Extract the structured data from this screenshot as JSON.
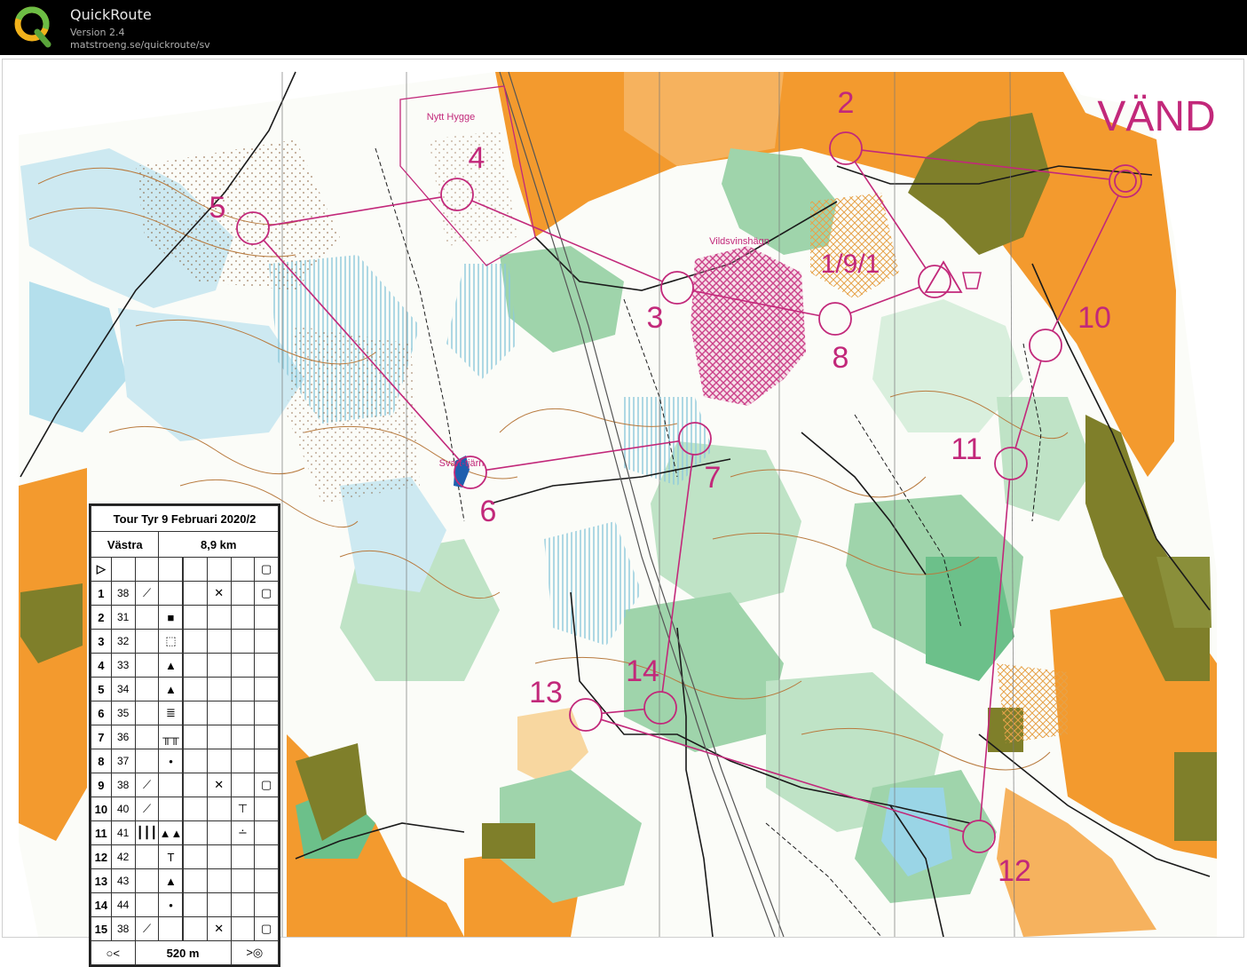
{
  "app": {
    "title": "QuickRoute",
    "version": "Version 2.4",
    "url": "matstroeng.se/quickroute/sv"
  },
  "colors": {
    "course": "#c2287a",
    "open_land": "#f39a2e",
    "forest_green": "#9fd4ab",
    "forest_dark": "#6cc08a",
    "water_blue": "#9ad5e6",
    "settlement": "#7f7f2a"
  },
  "map": {
    "turn_label": "VÄND",
    "place_labels": [
      "Nytt Hygge",
      "Vildsvinshägn",
      "Svart-tjärn"
    ],
    "controls": [
      {
        "label": "1/9/1"
      },
      {
        "label": "2"
      },
      {
        "label": "3"
      },
      {
        "label": "4"
      },
      {
        "label": "5"
      },
      {
        "label": "6"
      },
      {
        "label": "7"
      },
      {
        "label": "8"
      },
      {
        "label": "10"
      },
      {
        "label": "11"
      },
      {
        "label": "12"
      },
      {
        "label": "13"
      },
      {
        "label": "14"
      }
    ]
  },
  "description_sheet": {
    "title": "Tour Tyr 9 Februari 2020/2",
    "class": "Västra",
    "length": "8,9 km",
    "start_symbol": "▷",
    "rows": [
      {
        "n": "1",
        "code": "38",
        "c": "⟋",
        "d": "",
        "e": "",
        "f": "✕",
        "g": "",
        "h": "▢"
      },
      {
        "n": "2",
        "code": "31",
        "c": "",
        "d": "■",
        "e": "",
        "f": "",
        "g": "",
        "h": ""
      },
      {
        "n": "3",
        "code": "32",
        "c": "",
        "d": "⬚",
        "e": "",
        "f": "",
        "g": "",
        "h": ""
      },
      {
        "n": "4",
        "code": "33",
        "c": "",
        "d": "▲",
        "e": "",
        "f": "",
        "g": "",
        "h": ""
      },
      {
        "n": "5",
        "code": "34",
        "c": "",
        "d": "▲",
        "e": "",
        "f": "",
        "g": "",
        "h": ""
      },
      {
        "n": "6",
        "code": "35",
        "c": "",
        "d": "≣",
        "e": "",
        "f": "",
        "g": "",
        "h": ""
      },
      {
        "n": "7",
        "code": "36",
        "c": "",
        "d": "╥╥",
        "e": "",
        "f": "",
        "g": "",
        "h": ""
      },
      {
        "n": "8",
        "code": "37",
        "c": "",
        "d": "•",
        "e": "",
        "f": "",
        "g": "",
        "h": ""
      },
      {
        "n": "9",
        "code": "38",
        "c": "⟋",
        "d": "",
        "e": "",
        "f": "✕",
        "g": "",
        "h": "▢"
      },
      {
        "n": "10",
        "code": "40",
        "c": "⟋",
        "d": "",
        "e": "",
        "f": "",
        "g": "⊤",
        "h": ""
      },
      {
        "n": "11",
        "code": "41",
        "c": "┃┃┃",
        "d": "▲▲",
        "e": "",
        "f": "",
        "g": "∸",
        "h": ""
      },
      {
        "n": "12",
        "code": "42",
        "c": "",
        "d": "T",
        "e": "",
        "f": "",
        "g": "",
        "h": ""
      },
      {
        "n": "13",
        "code": "43",
        "c": "",
        "d": "▲",
        "e": "",
        "f": "",
        "g": "",
        "h": ""
      },
      {
        "n": "14",
        "code": "44",
        "c": "",
        "d": "•",
        "e": "",
        "f": "",
        "g": "",
        "h": ""
      },
      {
        "n": "15",
        "code": "38",
        "c": "⟋",
        "d": "",
        "e": "",
        "f": "✕",
        "g": "",
        "h": "▢"
      }
    ],
    "finish": {
      "left": "○<",
      "distance": "520 m",
      "right": ">◎"
    }
  }
}
